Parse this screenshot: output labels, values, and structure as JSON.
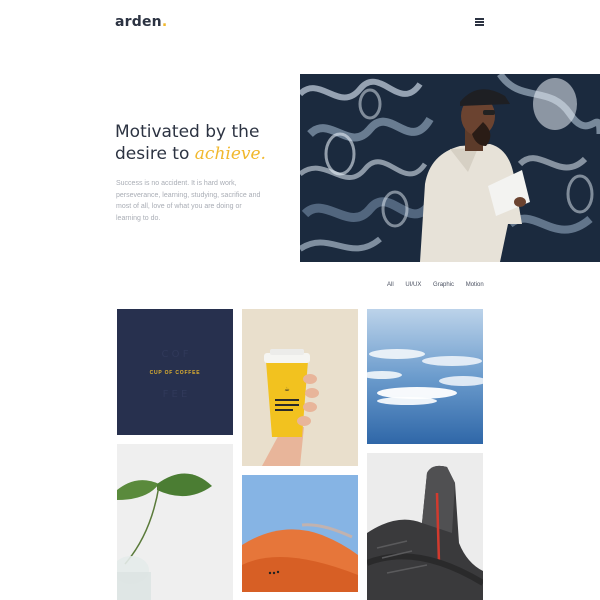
{
  "header": {
    "logo_text": "arden",
    "logo_dot": ".",
    "menu_icon": "hamburger-menu-icon"
  },
  "hero": {
    "title_line1": "Motivated by the",
    "title_line2_prefix": "desire to ",
    "title_accent": "achieve.",
    "body": "Success is no accident. It is hard work, perseverance, learning, studying, sacrifice and most of all, love of what you are doing or learning to do.",
    "accent_color": "#f1b82d"
  },
  "portfolio": {
    "filters": [
      "All",
      "UI/UX",
      "Graphic",
      "Motion"
    ],
    "tiles": [
      {
        "label": "CUP OF COFFEE"
      }
    ]
  }
}
